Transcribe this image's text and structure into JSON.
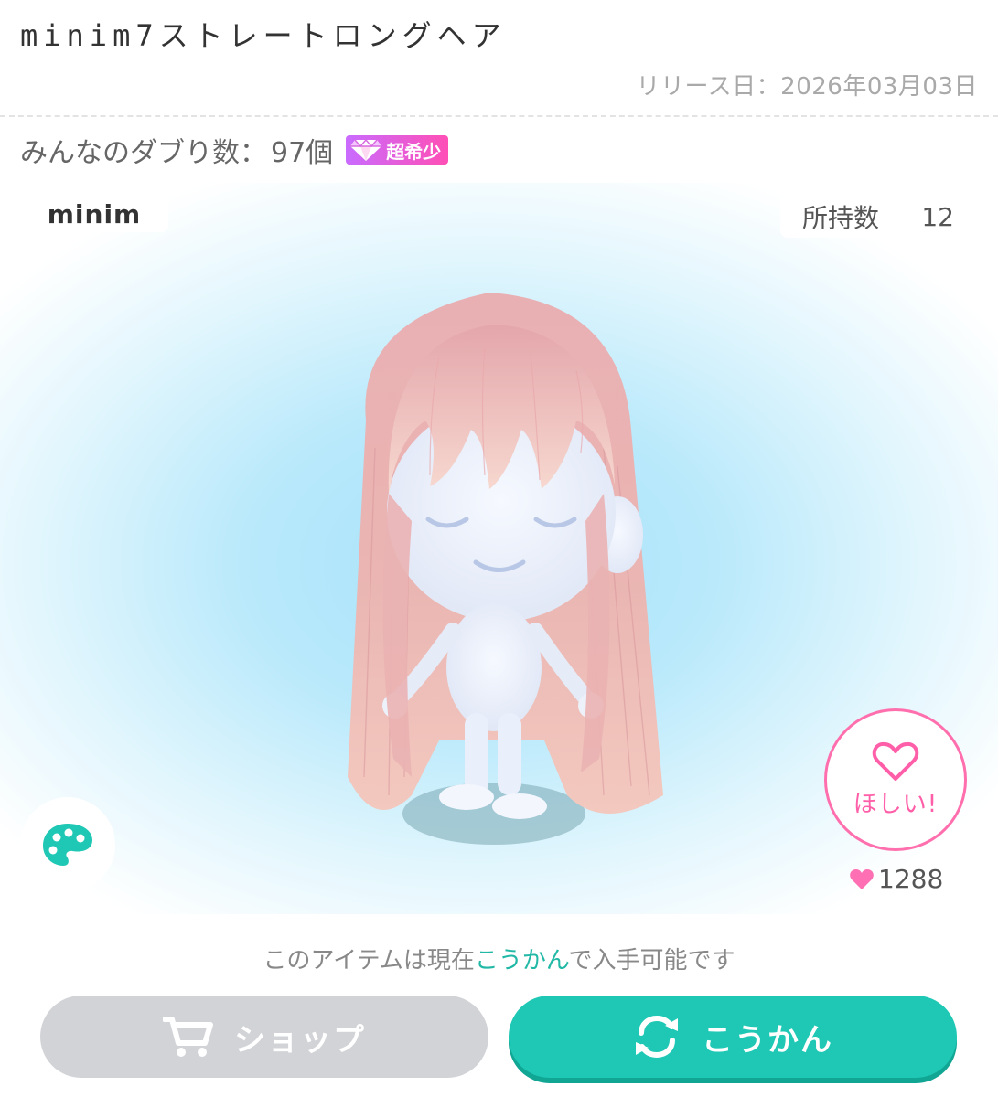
{
  "item": {
    "title": "minim7ストレートロングヘア",
    "release": "リリース日：2026年03月03日"
  },
  "dupes": {
    "label": "みんなのダブり数：",
    "count": "97個",
    "rarity": "超希少"
  },
  "stage": {
    "brand": "minim",
    "owned_label": "所持数",
    "owned_count": "12"
  },
  "want": {
    "label": "ほしい!",
    "likes": "1288"
  },
  "availability": {
    "prefix": "このアイテムは現在",
    "highlight": "こうかん",
    "suffix": "で入手可能です"
  },
  "buttons": {
    "shop": "ショップ",
    "trade": "こうかん"
  },
  "colors": {
    "accent": "#1ec8b4",
    "pink": "#ff6fae",
    "disabled": "#d2d3d7"
  },
  "icons": [
    "gem-icon",
    "palette-icon",
    "heart-icon",
    "cart-icon",
    "exchange-icon"
  ]
}
